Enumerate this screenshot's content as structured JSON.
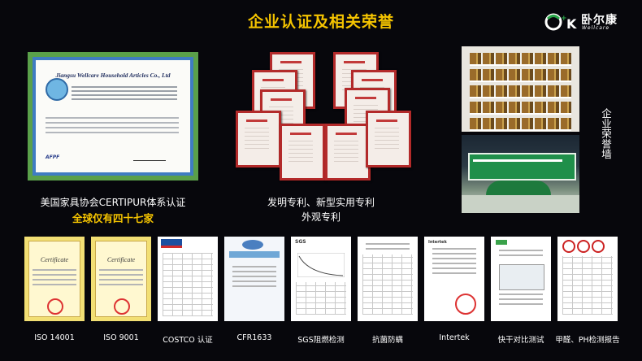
{
  "header": {
    "title": "企业认证及相关荣誉"
  },
  "logo": {
    "mark_text": "O+K",
    "brand_cn": "卧尔康",
    "brand_en": "Wellcare"
  },
  "certificate": {
    "company": "Jiangsu Wellcare Household Articles Co., Ltd",
    "caption": "美国家具协会CERTIPUR体系认证",
    "highlight": "全球仅有四十七家"
  },
  "patents": {
    "caption_line1": "发明专利、新型实用专利",
    "caption_line2": "外观专利"
  },
  "honor_wall": {
    "label": "企业荣誉墙"
  },
  "thumbnails": [
    {
      "label": "ISO 14001",
      "heading": "Certificate"
    },
    {
      "label": "ISO 9001",
      "heading": "Certificate"
    },
    {
      "label": "COSTCO 认证",
      "heading": "COSTCO"
    },
    {
      "label": "CFR1633",
      "heading": "ACHIEVEMENT AWARD"
    },
    {
      "label": "SGS阻燃检测",
      "heading": "SGS"
    },
    {
      "label": "抗菌防螨",
      "heading": ""
    },
    {
      "label": "Intertek",
      "heading": "Intertek"
    },
    {
      "label": "快干对比测试",
      "heading": ""
    },
    {
      "label": "甲醛、PH检测报告",
      "heading": ""
    }
  ],
  "colors": {
    "background": "#07070c",
    "title": "#f5c400",
    "highlight": "#f5c400",
    "logo_green": "#2aa84a"
  }
}
